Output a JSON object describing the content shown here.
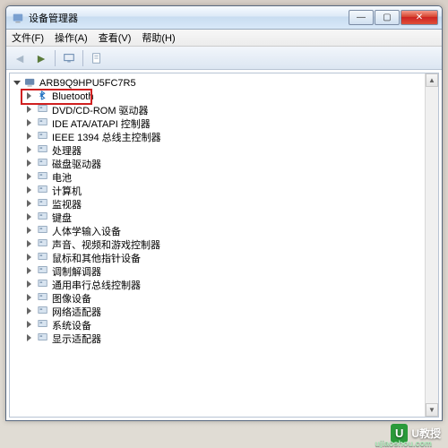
{
  "window": {
    "title": "设备管理器",
    "buttons": {
      "min": "—",
      "max": "▢",
      "close": "✕"
    }
  },
  "menu": {
    "file": "文件(F)",
    "action": "操作(A)",
    "view": "查看(V)",
    "help": "帮助(H)"
  },
  "tree": {
    "root": "ARB9Q9HPU5FC7R5",
    "items": [
      {
        "label": "Bluetooth",
        "highlighted": true
      },
      {
        "label": "DVD/CD-ROM 驱动器"
      },
      {
        "label": "IDE ATA/ATAPI 控制器"
      },
      {
        "label": "IEEE 1394 总线主控制器"
      },
      {
        "label": "处理器"
      },
      {
        "label": "磁盘驱动器"
      },
      {
        "label": "电池"
      },
      {
        "label": "计算机"
      },
      {
        "label": "监视器"
      },
      {
        "label": "键盘"
      },
      {
        "label": "人体学输入设备"
      },
      {
        "label": "声音、视频和游戏控制器"
      },
      {
        "label": "鼠标和其他指针设备"
      },
      {
        "label": "调制解调器"
      },
      {
        "label": "通用串行总线控制器"
      },
      {
        "label": "图像设备"
      },
      {
        "label": "网络适配器"
      },
      {
        "label": "系统设备"
      },
      {
        "label": "显示适配器"
      }
    ]
  },
  "watermark": {
    "badge": "U",
    "text": "U教授",
    "sub": "ujiaoshou.com"
  }
}
